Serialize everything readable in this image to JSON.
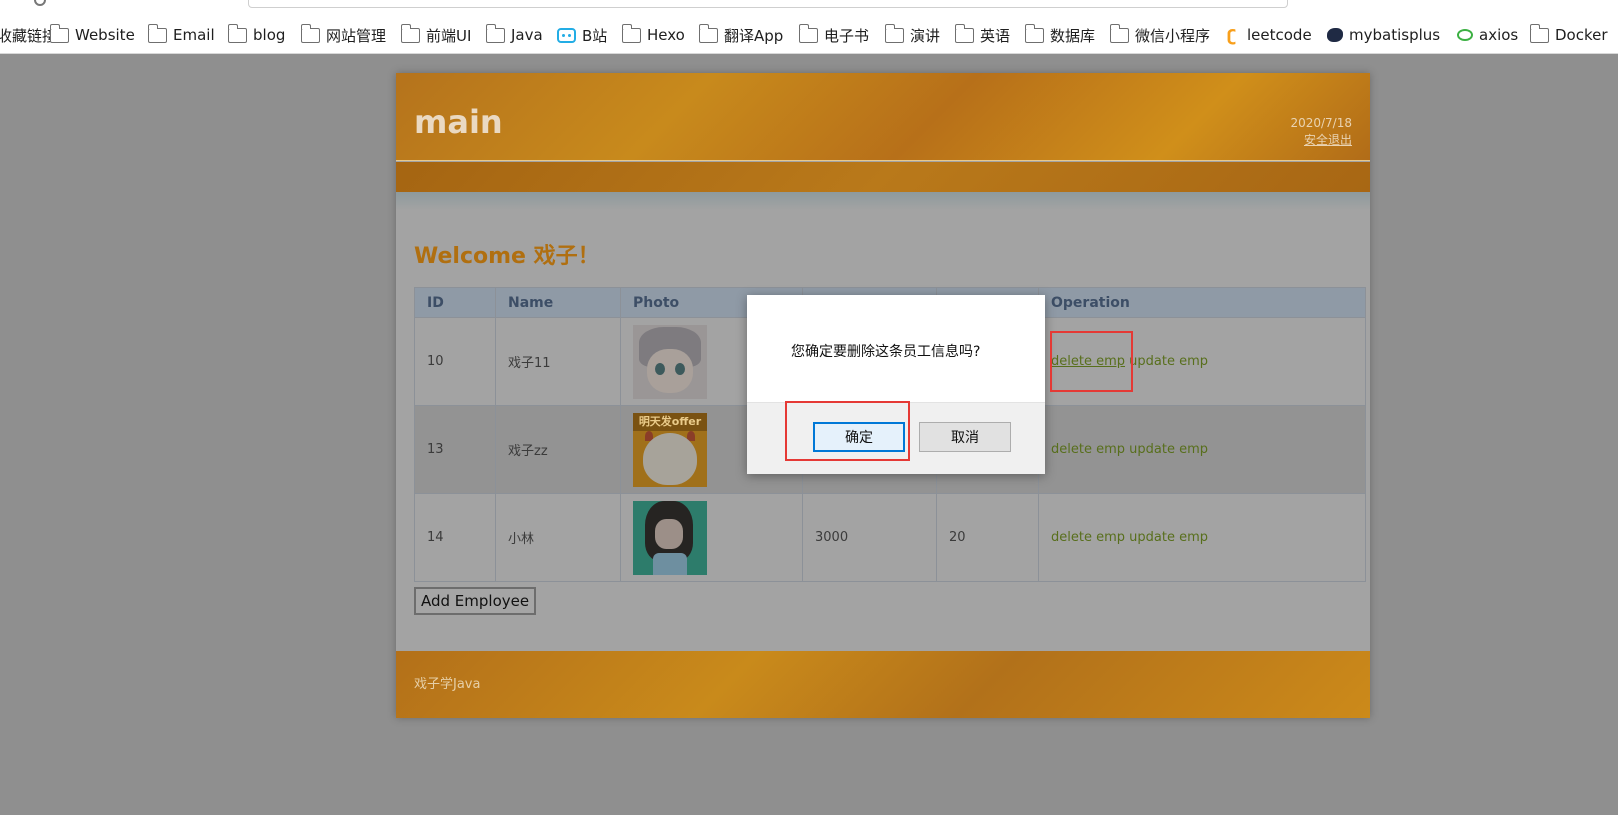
{
  "bookmarks": [
    {
      "label": "收藏链接",
      "icon": "folder-icon"
    },
    {
      "label": "Website",
      "icon": "folder-icon"
    },
    {
      "label": "Email",
      "icon": "folder-icon"
    },
    {
      "label": "blog",
      "icon": "folder-icon"
    },
    {
      "label": "网站管理",
      "icon": "folder-icon"
    },
    {
      "label": "前端UI",
      "icon": "folder-icon"
    },
    {
      "label": "Java",
      "icon": "folder-icon"
    },
    {
      "label": "B站",
      "icon": "bilibili-icon"
    },
    {
      "label": "Hexo",
      "icon": "folder-icon"
    },
    {
      "label": "翻译App",
      "icon": "folder-icon"
    },
    {
      "label": "电子书",
      "icon": "folder-icon"
    },
    {
      "label": "演讲",
      "icon": "folder-icon"
    },
    {
      "label": "英语",
      "icon": "folder-icon"
    },
    {
      "label": "数据库",
      "icon": "folder-icon"
    },
    {
      "label": "微信小程序",
      "icon": "folder-icon"
    },
    {
      "label": "leetcode",
      "icon": "leetcode-icon"
    },
    {
      "label": "mybatisplus",
      "icon": "mybatis-bird-icon"
    },
    {
      "label": "axios",
      "icon": "axios-icon"
    },
    {
      "label": "Docker",
      "icon": "folder-icon"
    }
  ],
  "header": {
    "logo": "main",
    "date": "2020/7/18",
    "logout": "安全退出"
  },
  "welcome": "Welcome 戏子！",
  "table": {
    "columns": [
      "ID",
      "Name",
      "Photo",
      "",
      "",
      "Operation"
    ],
    "rows": [
      {
        "id": "10",
        "name": "戏子11",
        "salary": "",
        "age": "",
        "delete": "delete emp",
        "update": "update emp"
      },
      {
        "id": "13",
        "name": "戏子zz",
        "salary": "",
        "age": "",
        "delete": "delete emp",
        "update": "update emp"
      },
      {
        "id": "14",
        "name": "小林",
        "salary": "3000",
        "age": "20",
        "delete": "delete emp",
        "update": "update emp"
      }
    ],
    "photo_badge": "明天发offer"
  },
  "add_button": "Add Employee",
  "footer": "戏子学Java",
  "dialog": {
    "message": "您确定要删除这条员工信息吗?",
    "ok": "确定",
    "cancel": "取消"
  },
  "colors": {
    "theme_orange": "#f0a020",
    "link_green": "#586f1c",
    "annotation_red": "#e53935",
    "dialog_ok_border": "#0078d7"
  }
}
